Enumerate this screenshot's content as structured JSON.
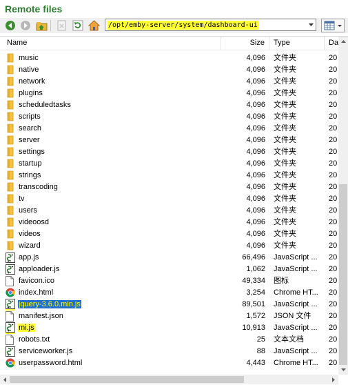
{
  "panel": {
    "title": "Remote files"
  },
  "toolbar": {
    "path": "/opt/emby-server/system/dashboard-ui",
    "path_highlight": "#ffff33"
  },
  "columns": {
    "name": "Name",
    "size": "Size",
    "type": "Type",
    "date": "Da"
  },
  "rows": [
    {
      "name": "music",
      "size": "4,096",
      "type": "文件夹",
      "date": "20",
      "icon": "folder-icon"
    },
    {
      "name": "native",
      "size": "4,096",
      "type": "文件夹",
      "date": "20",
      "icon": "folder-icon"
    },
    {
      "name": "network",
      "size": "4,096",
      "type": "文件夹",
      "date": "20",
      "icon": "folder-icon"
    },
    {
      "name": "plugins",
      "size": "4,096",
      "type": "文件夹",
      "date": "20",
      "icon": "folder-icon"
    },
    {
      "name": "scheduledtasks",
      "size": "4,096",
      "type": "文件夹",
      "date": "20",
      "icon": "folder-icon"
    },
    {
      "name": "scripts",
      "size": "4,096",
      "type": "文件夹",
      "date": "20",
      "icon": "folder-icon"
    },
    {
      "name": "search",
      "size": "4,096",
      "type": "文件夹",
      "date": "20",
      "icon": "folder-icon"
    },
    {
      "name": "server",
      "size": "4,096",
      "type": "文件夹",
      "date": "20",
      "icon": "folder-icon"
    },
    {
      "name": "settings",
      "size": "4,096",
      "type": "文件夹",
      "date": "20",
      "icon": "folder-icon"
    },
    {
      "name": "startup",
      "size": "4,096",
      "type": "文件夹",
      "date": "20",
      "icon": "folder-icon"
    },
    {
      "name": "strings",
      "size": "4,096",
      "type": "文件夹",
      "date": "20",
      "icon": "folder-icon"
    },
    {
      "name": "transcoding",
      "size": "4,096",
      "type": "文件夹",
      "date": "20",
      "icon": "folder-icon"
    },
    {
      "name": "tv",
      "size": "4,096",
      "type": "文件夹",
      "date": "20",
      "icon": "folder-icon"
    },
    {
      "name": "users",
      "size": "4,096",
      "type": "文件夹",
      "date": "20",
      "icon": "folder-icon"
    },
    {
      "name": "videoosd",
      "size": "4,096",
      "type": "文件夹",
      "date": "20",
      "icon": "folder-icon"
    },
    {
      "name": "videos",
      "size": "4,096",
      "type": "文件夹",
      "date": "20",
      "icon": "folder-icon"
    },
    {
      "name": "wizard",
      "size": "4,096",
      "type": "文件夹",
      "date": "20",
      "icon": "folder-icon"
    },
    {
      "name": "app.js",
      "size": "66,496",
      "type": "JavaScript ...",
      "date": "20",
      "icon": "js-file-icon"
    },
    {
      "name": "apploader.js",
      "size": "1,062",
      "type": "JavaScript ...",
      "date": "20",
      "icon": "js-file-icon"
    },
    {
      "name": "favicon.ico",
      "size": "49,334",
      "type": "图标",
      "date": "20",
      "icon": "blank-file-icon"
    },
    {
      "name": "index.html",
      "size": "3,254",
      "type": "Chrome HT...",
      "date": "20",
      "icon": "chrome-icon"
    },
    {
      "name": "jquery-3.6.0.min.js",
      "size": "89,501",
      "type": "JavaScript ...",
      "date": "20",
      "icon": "js-file-icon",
      "highlight": "blue"
    },
    {
      "name": "manifest.json",
      "size": "1,572",
      "type": "JSON 文件",
      "date": "20",
      "icon": "blank-file-icon"
    },
    {
      "name": "mi.js",
      "size": "10,913",
      "type": "JavaScript ...",
      "date": "20",
      "icon": "js-file-icon",
      "highlight": "yellow"
    },
    {
      "name": "robots.txt",
      "size": "25",
      "type": "文本文档",
      "date": "20",
      "icon": "blank-file-icon"
    },
    {
      "name": "serviceworker.js",
      "size": "88",
      "type": "JavaScript ...",
      "date": "20",
      "icon": "js-file-icon"
    },
    {
      "name": "userpassword.html",
      "size": "4,443",
      "type": "Chrome HT...",
      "date": "20",
      "icon": "chrome-icon"
    }
  ],
  "colors": {
    "title": "#2e7d32",
    "folder": "#f5c242",
    "selection": "#1f6fd1",
    "marker": "#ffff33"
  }
}
